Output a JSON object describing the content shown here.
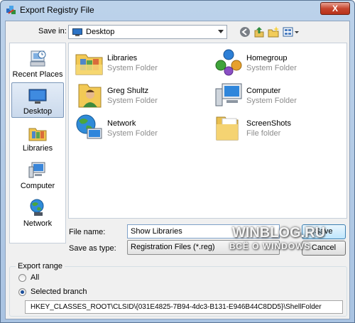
{
  "window": {
    "title": "Export Registry File",
    "close_glyph": "X"
  },
  "save_in": {
    "label": "Save in:",
    "value": "Desktop",
    "icons": [
      "back-icon",
      "up-folder-icon",
      "new-folder-icon",
      "views-menu-icon"
    ]
  },
  "places": [
    {
      "label": "Recent Places",
      "icon": "recent-places-icon"
    },
    {
      "label": "Desktop",
      "icon": "desktop-icon",
      "selected": true
    },
    {
      "label": "Libraries",
      "icon": "libraries-icon"
    },
    {
      "label": "Computer",
      "icon": "computer-icon"
    },
    {
      "label": "Network",
      "icon": "network-icon"
    }
  ],
  "items": [
    {
      "name": "Libraries",
      "type": "System Folder",
      "icon": "libraries-folder-icon"
    },
    {
      "name": "Homegroup",
      "type": "System Folder",
      "icon": "homegroup-icon"
    },
    {
      "name": "Greg Shultz",
      "type": "System Folder",
      "icon": "user-folder-icon"
    },
    {
      "name": "Computer",
      "type": "System Folder",
      "icon": "computer-icon"
    },
    {
      "name": "Network",
      "type": "System Folder",
      "icon": "network-globe-icon"
    },
    {
      "name": "ScreenShots",
      "type": "File folder",
      "icon": "folder-icon"
    }
  ],
  "file_name": {
    "label": "File name:",
    "value": "Show Libraries"
  },
  "save_as_type": {
    "label": "Save as type:",
    "value": "Registration Files (*.reg)"
  },
  "buttons": {
    "save": "Save",
    "cancel": "Cancel"
  },
  "watermark": {
    "line1": "WINBLOG.RU",
    "line2": "ВСЁ О WINDOWS"
  },
  "export_range": {
    "title": "Export range",
    "all_label": "All",
    "selected_label": "Selected branch",
    "selected": "selected_branch",
    "branch_path": "HKEY_CLASSES_ROOT\\CLSID\\{031E4825-7B94-4dc3-B131-E946B44C8DD5}\\ShellFolder"
  },
  "colors": {
    "title_bar": "#bcd2ea",
    "close_button": "#c7462f",
    "selection": "#cad9ec"
  }
}
